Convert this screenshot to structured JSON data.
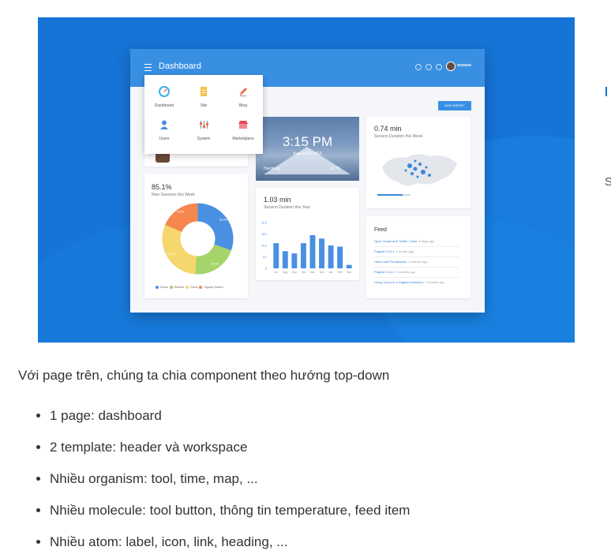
{
  "dashboard": {
    "title": "Dashboard",
    "add_widget": "ADD WIDGET",
    "tools": [
      {
        "label": "Dashboard",
        "icon": "gauge-icon"
      },
      {
        "label": "Site",
        "icon": "document-icon"
      },
      {
        "label": "Blog",
        "icon": "pencil-icon"
      },
      {
        "label": "Users",
        "icon": "user-icon"
      },
      {
        "label": "System",
        "icon": "sliders-icon"
      },
      {
        "label": "Marketplace",
        "icon": "store-icon"
      }
    ],
    "sessions": {
      "value": "85.1%",
      "label": "New Sessions this Week",
      "slices": [
        {
          "name": "Social",
          "value": 30.3,
          "color": "#4a90e2"
        },
        {
          "name": "Referrer",
          "value": 20.9,
          "color": "#a5d46a"
        },
        {
          "name": "Direct",
          "value": 30.2,
          "color": "#f5d76e"
        },
        {
          "name": "Organic Search",
          "value": 18.6,
          "color": "#f5874f"
        }
      ],
      "slice_labels": [
        "30.3%",
        "20.9%",
        "30.2%",
        "18.6%"
      ]
    },
    "time": {
      "clock": "3:15 PM",
      "date": "August 20, 2015",
      "city": "Hamburg",
      "temp": "13 °C"
    },
    "duration_map": {
      "value": "0.74 min",
      "label": "Session Duration this Week"
    },
    "duration_year": {
      "value": "1.03 min",
      "label": "Session Duration this Year"
    },
    "feed": {
      "title": "Feed",
      "items": [
        {
          "text": "Open Graph and Twitter Cards",
          "time": "6 days ago"
        },
        {
          "text": "Pagekit 0.10.4",
          "time": "1 month ago"
        },
        {
          "text": "Users and Permissions",
          "time": "2 months ago"
        },
        {
          "text": "Pagekit 0.10.2",
          "time": "2 months ago"
        },
        {
          "text": "Using Vue.js in a Pagekit extension",
          "time": "4 months ago"
        }
      ]
    }
  },
  "chart_data": {
    "type": "bar",
    "categories": [
      "Jul",
      "Aug",
      "Sep",
      "Oct",
      "Nov",
      "Dec",
      "Jan",
      "Feb",
      "Mar"
    ],
    "values": [
      11,
      7.5,
      6.5,
      11,
      14.5,
      13,
      10,
      9.5,
      1.5
    ],
    "ylim": [
      0,
      20
    ],
    "yticks": [
      "20.0",
      "15.0",
      "10.0",
      "5.0",
      "0"
    ],
    "color": "#4a90e2"
  },
  "article": {
    "intro": "Với page trên, chúng ta chia component theo hướng top-down",
    "items": [
      "1 page: dashboard",
      "2 template: header và workspace",
      "Nhiều organism: tool, time, map, ...",
      "Nhiều molecule: tool button, thông tin temperature, feed item",
      "Nhiều atom: label, icon, link, heading, ..."
    ],
    "side_letter": "S"
  }
}
